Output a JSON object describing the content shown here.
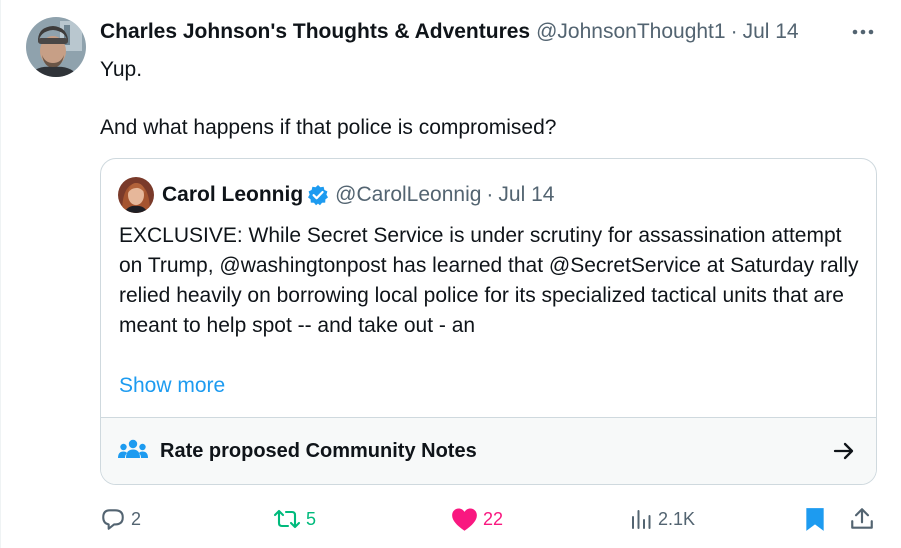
{
  "tweet": {
    "display_name": "Charles Johnson's Thoughts & Adventures",
    "handle": "@JohnsonThought1",
    "separator": "·",
    "date": "Jul 14",
    "more_icon": "more-horizontal-icon",
    "text": "Yup.\n\nAnd what happens if that police is compromised?"
  },
  "quote": {
    "display_name": "Carol Leonnig",
    "verified_icon": "verified-badge-icon",
    "handle": "@CarolLeonnig",
    "separator": "·",
    "date": "Jul 14",
    "text": "EXCLUSIVE: While Secret Service is under scrutiny for assassination attempt on Trump, @washingtonpost has learned that @SecretService at Saturday rally relied heavily on borrowing local police for its specialized tactical units that are meant to help spot -- and take out - an",
    "show_more": "Show more"
  },
  "community_notes": {
    "icon": "community-notes-icon",
    "label": "Rate proposed Community Notes",
    "arrow_icon": "arrow-right-icon"
  },
  "actions": {
    "reply": {
      "icon": "reply-icon",
      "count": "2"
    },
    "retweet": {
      "icon": "retweet-icon",
      "count": "5",
      "active": true
    },
    "like": {
      "icon": "heart-icon",
      "count": "22",
      "active": true
    },
    "views": {
      "icon": "views-icon",
      "count": "2.1K"
    },
    "bookmark": {
      "icon": "bookmark-icon",
      "active": true
    },
    "share": {
      "icon": "share-icon"
    }
  },
  "colors": {
    "text": "#0f1419",
    "secondary": "#536471",
    "accent": "#1d9bf0",
    "retweet_active": "#00ba7c",
    "like_active": "#f91880",
    "border": "#cfd9de"
  }
}
